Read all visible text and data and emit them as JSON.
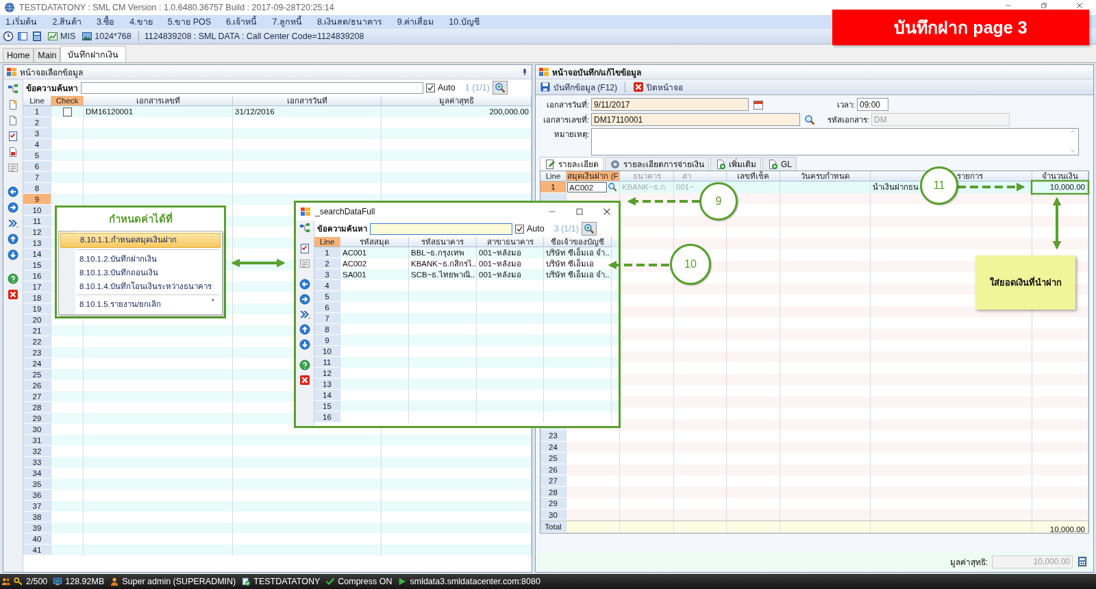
{
  "window": {
    "title": "TESTDATATONY : SML CM Version : 1.0.6480.36757  Build : 2017-09-28T20:25:14"
  },
  "banner": "บันทึกฝาก page 3",
  "menu": [
    "1.เริ่มต้น",
    "2.สินค้า",
    "3.ซื้อ",
    "4.ขาย",
    "5.ขาย POS",
    "6.เจ้าหนี้",
    "7.ลูกหนี้",
    "8.เงินสด/ธนาคาร",
    "9.ค่าเสื่อม",
    "10.บัญชี"
  ],
  "toolbar": {
    "mis": "MIS",
    "resolution": "1024*768",
    "info": "1124839208 : SML DATA : Call Center Code=1124839208"
  },
  "tabs": [
    {
      "label": "Home",
      "selected": false
    },
    {
      "label": "Main",
      "selected": false
    },
    {
      "label": "บันทึกฝากเงิน",
      "selected": true
    }
  ],
  "left_panel": {
    "title": "หน้าจอเลือกข้อมูล",
    "search": {
      "label": "ข้อความค้นหา"
    },
    "auto": {
      "label": "Auto",
      "checked": true
    },
    "count": "1 (1/1)",
    "columns": [
      {
        "label": "Line",
        "selected": false
      },
      {
        "label": "Check",
        "selected": true
      },
      {
        "label": "เอกสารเลขที่",
        "selected": false
      },
      {
        "label": "เอกสารวันที่",
        "selected": false
      },
      {
        "label": "มูลค่าสุทธิ",
        "selected": false
      }
    ],
    "rows": [
      {
        "line": "1",
        "selected": false,
        "checked": false,
        "doc_no": "DM16120001",
        "date": "31/12/2016",
        "amount": "200,000.00"
      },
      {
        "line": "2",
        "selected": false
      },
      {
        "line": "3",
        "selected": false
      },
      {
        "line": "4",
        "selected": false
      },
      {
        "line": "5",
        "selected": false
      },
      {
        "line": "6",
        "selected": false
      },
      {
        "line": "7",
        "selected": false
      },
      {
        "line": "8",
        "selected": false
      },
      {
        "line": "9",
        "selected": true
      },
      {
        "line": "10",
        "selected": false
      },
      {
        "line": "11",
        "selected": false
      },
      {
        "line": "12",
        "selected": false
      },
      {
        "line": "13",
        "selected": false
      },
      {
        "line": "14",
        "selected": false
      },
      {
        "line": "15",
        "selected": false
      },
      {
        "line": "16",
        "selected": false
      },
      {
        "line": "17",
        "selected": false
      },
      {
        "line": "18",
        "selected": false
      },
      {
        "line": "19",
        "selected": false
      },
      {
        "line": "20",
        "selected": false
      },
      {
        "line": "21",
        "selected": false
      },
      {
        "line": "22",
        "selected": false
      },
      {
        "line": "23",
        "selected": false
      },
      {
        "line": "24",
        "selected": false
      },
      {
        "line": "25",
        "selected": false
      },
      {
        "line": "26",
        "selected": false
      },
      {
        "line": "27",
        "selected": false
      },
      {
        "line": "28",
        "selected": false
      },
      {
        "line": "29",
        "selected": false
      },
      {
        "line": "30",
        "selected": false
      },
      {
        "line": "31",
        "selected": false
      },
      {
        "line": "32",
        "selected": false
      },
      {
        "line": "33",
        "selected": false
      },
      {
        "line": "34",
        "selected": false
      },
      {
        "line": "35",
        "selected": false
      },
      {
        "line": "36",
        "selected": false
      },
      {
        "line": "37",
        "selected": false
      },
      {
        "line": "38",
        "selected": false
      },
      {
        "line": "39",
        "selected": false
      },
      {
        "line": "40",
        "selected": false
      },
      {
        "line": "41",
        "selected": false
      }
    ]
  },
  "right_panel": {
    "title": "หน้าจอบันทึก/แก้ไขข้อมูล",
    "actions": [
      {
        "label": "บันทึกข้อมูล (F12)",
        "kind": "save"
      },
      {
        "label": "ปิดหน้าจอ",
        "kind": "close"
      }
    ],
    "form": {
      "doc_date": {
        "label": "เอกสารวันที่:",
        "value": "9/11/2017"
      },
      "time": {
        "label": "เวลา:",
        "value": "09:00"
      },
      "doc_no": {
        "label": "เอกสารเลขที่:",
        "value": "DM17110001"
      },
      "doc_code": {
        "label": "รหัสเอกสาร:",
        "value": "DM",
        "disabled": true
      },
      "remark": {
        "label": "หมายเหตุ:"
      }
    },
    "detail_tabs": [
      {
        "label": "รายละเอียด",
        "kind": "edit",
        "selected": true
      },
      {
        "label": "รายละเอียดการจ่ายเงิน",
        "kind": "coins",
        "selected": false
      },
      {
        "label": "เพิ่มเติม",
        "kind": "docplus",
        "selected": false
      },
      {
        "label": "GL",
        "kind": "docplus",
        "selected": false
      }
    ],
    "columns": [
      {
        "label": "Line",
        "selected": false,
        "disabled": false
      },
      {
        "label": "สมุดเงินฝาก (F",
        "selected": true,
        "disabled": false
      },
      {
        "label": "ธนาคาร",
        "selected": false,
        "disabled": true
      },
      {
        "label": "สา",
        "selected": false,
        "disabled": true
      },
      {
        "label": "เลขที่เช็ค",
        "selected": false,
        "disabled": false
      },
      {
        "label": "วันครบกำหนด",
        "selected": false,
        "disabled": false
      },
      {
        "label": "รายการ",
        "selected": false,
        "disabled": false
      },
      {
        "label": "จำนวนเงิน",
        "selected": false,
        "disabled": false
      }
    ],
    "rows": [
      {
        "line": "1",
        "selected": true,
        "account": "AC002",
        "bank": "KBANK~ธ.ก.",
        "branch": "001~",
        "description": "นำเงินฝากธน",
        "amount": "10,000.00"
      }
    ],
    "tail_lines": [
      "23",
      "24",
      "25",
      "26",
      "27",
      "28",
      "29",
      "30"
    ],
    "total": {
      "label": "Total",
      "amount": "10,000.00"
    },
    "net": {
      "label": "มูลค่าสุทธิ:",
      "value": "10,000.00"
    }
  },
  "menu_popup": {
    "title": "กำหนดค่าได้ที่",
    "items": [
      {
        "label": "8.10.1.1.กำหนดสมุดเงินฝาก",
        "selected": true,
        "separator_before": false,
        "submenu": false
      },
      {
        "label": "8.10.1.2.บันทึกฝากเงิน",
        "selected": false,
        "separator_before": true,
        "submenu": false
      },
      {
        "label": "8.10.1.3.บันทึกถอนเงิน",
        "selected": false,
        "separator_before": false,
        "submenu": false
      },
      {
        "label": "8.10.1.4.บันทึกโอนเงินระหว่างธนาคาร",
        "selected": false,
        "separator_before": false,
        "submenu": false
      },
      {
        "label": "8.10.1.5.รายงาน/ยกเลิก",
        "selected": false,
        "separator_before": true,
        "submenu": true
      }
    ]
  },
  "search_popup": {
    "title": "_searchDataFull",
    "search": {
      "label": "ข้อความค้นหา"
    },
    "auto": {
      "label": "Auto",
      "checked": true
    },
    "count": "3 (1/1)",
    "columns": [
      {
        "label": "Line",
        "selected": true
      },
      {
        "label": "รหัสสมุด",
        "selected": false
      },
      {
        "label": "รหัสธนาคาร",
        "selected": false
      },
      {
        "label": "สาขาธนาคาร",
        "selected": false
      },
      {
        "label": "ชื่อเจ้าของบัญชี",
        "selected": false
      }
    ],
    "rows": [
      {
        "line": "1",
        "book": "AC001",
        "bank": "BBL~ธ.กรุงเทพ",
        "branch": "001~หลังมอ",
        "owner": "บริษัท ซีเอ็มเอ จำ.."
      },
      {
        "line": "2",
        "book": "AC002",
        "bank": "KBANK~ธ.กสิกรไ..",
        "branch": "001~หลังมอ",
        "owner": "บริษัท ซีเอ็มเอ"
      },
      {
        "line": "3",
        "book": "SA001",
        "bank": "SCB~ธ.ไทยพาณิ..",
        "branch": "001~หลังมอ",
        "owner": "บริษัท ซีเอ็มเอ จำ.."
      }
    ],
    "empty_lines": [
      "4",
      "5",
      "6",
      "7",
      "8",
      "9",
      "10",
      "11",
      "12",
      "13",
      "14",
      "15",
      "16"
    ]
  },
  "callouts": [
    "9",
    "10",
    "11"
  ],
  "note": "ใส่ยอดเงินที่นำฝาก",
  "status_bar": [
    {
      "text": "2/500",
      "kind": "users"
    },
    {
      "text": "128.92MB",
      "kind": "monitor"
    },
    {
      "text": "Super admin (SUPERADMIN)",
      "kind": "user"
    },
    {
      "text": "TESTDATATONY",
      "kind": "database"
    },
    {
      "text": "Compress ON",
      "kind": "check"
    },
    {
      "text": "smldata3.smldatacenter.com:8080",
      "kind": "play"
    }
  ]
}
